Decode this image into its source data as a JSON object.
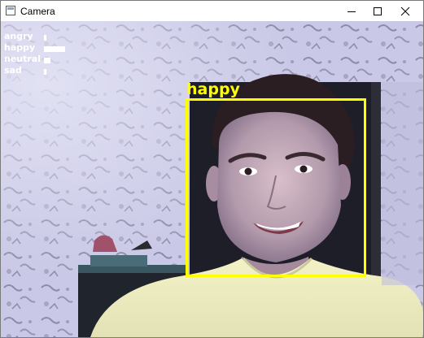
{
  "window": {
    "title": "Camera"
  },
  "controls": {
    "minimize": "minimize",
    "maximize": "maximize",
    "close": "close"
  },
  "emotion_scores": {
    "items": [
      {
        "label": "angry",
        "score": 0.06
      },
      {
        "label": "happy",
        "score": 0.85
      },
      {
        "label": "neutral",
        "score": 0.28
      },
      {
        "label": "sad",
        "score": 0.05
      }
    ]
  },
  "detection": {
    "label": "happy",
    "box_color": "#ffff00"
  },
  "colors": {
    "hud_text": "#ffffff",
    "detection": "#ffff00"
  }
}
